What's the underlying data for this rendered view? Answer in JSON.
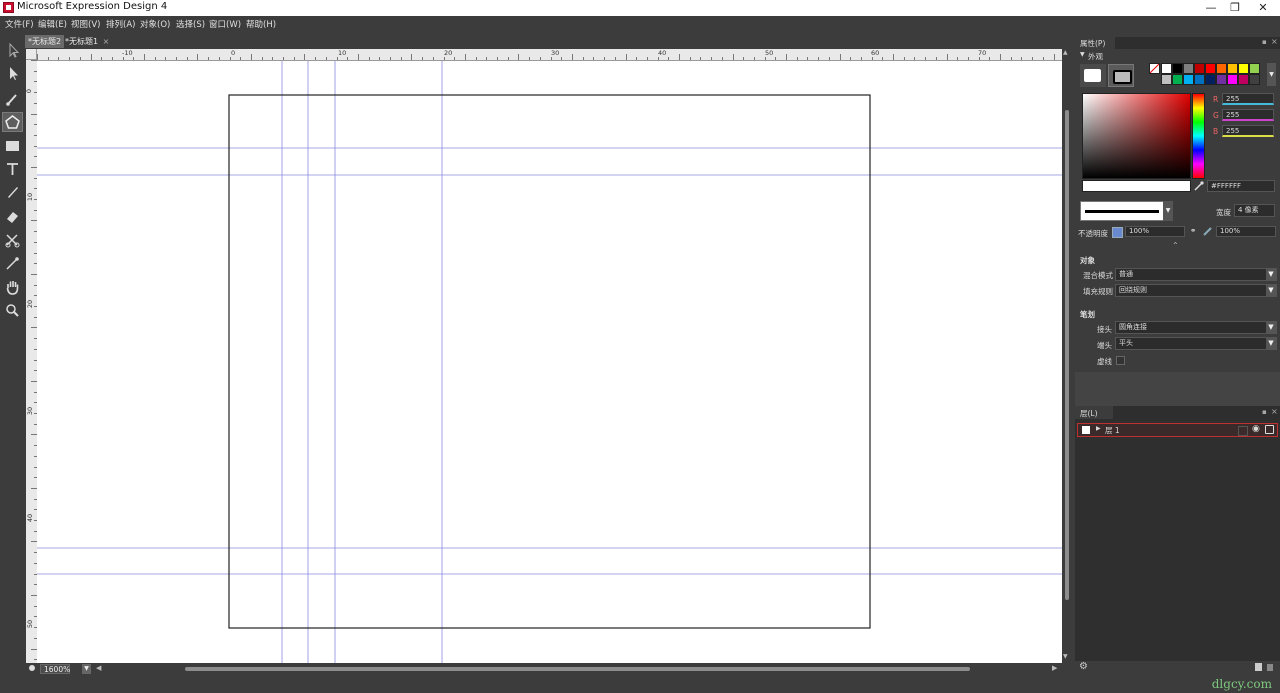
{
  "window": {
    "title": "Microsoft Expression Design 4",
    "controls": [
      "—",
      "❐",
      "✕"
    ]
  },
  "menu": [
    "文件(F)",
    "编辑(E)",
    "视图(V)",
    "排列(A)",
    "对象(O)",
    "选择(S)",
    "窗口(W)",
    "帮助(H)"
  ],
  "tabs": [
    {
      "label": "*无标题2",
      "active": true
    },
    {
      "label": "*无标题1",
      "close": "×",
      "active": false
    }
  ],
  "tools": [
    "selection-icon",
    "direct-selection-icon",
    "paintbrush-icon",
    "polygon-icon",
    "rectangle-icon",
    "text-icon",
    "pen-icon",
    "eraser-icon",
    "scissors-icon",
    "eyedropper-icon",
    "hand-icon",
    "zoom-icon"
  ],
  "ruler": {
    "horizontal": [
      "-10",
      "0",
      "10",
      "20",
      "30",
      "40",
      "50",
      "60",
      "70"
    ],
    "vertical": [
      "0",
      "10",
      "20",
      "30",
      "40",
      "50"
    ]
  },
  "status": {
    "zoom": "1600%"
  },
  "properties": {
    "title": "属性(P)",
    "appearance": "外观",
    "rgb": {
      "r_label": "R",
      "r": "255",
      "g_label": "G",
      "g": "255",
      "b_label": "B",
      "b": "255"
    },
    "hex": "#FFFFFF",
    "width_label": "宽度",
    "width_value": "4 像素",
    "opacity_label": "不透明度",
    "opacity": "100%",
    "opacity2": "100%",
    "object_section": "对象",
    "blend_label": "混合模式",
    "blend_value": "普通",
    "fill_label": "填充规则",
    "fill_value": "回绕规则",
    "stroke_section": "笔划",
    "join_label": "接头",
    "join_value": "圆角连接",
    "cap_label": "端头",
    "cap_value": "平头",
    "dash_label": "虚线"
  },
  "swatches": [
    "#ffffff",
    "#000000",
    "#7f7f7f",
    "#c00000",
    "#ff0000",
    "#ff6600",
    "#ffc000",
    "#ffff00",
    "#92d050",
    "#bfbfbf",
    "#00b050",
    "#00b0f0",
    "#0070c0",
    "#002060",
    "#7030a0",
    "#ff00ff",
    "#c00060",
    "#404040"
  ],
  "layers": {
    "title": "层(L)",
    "items": [
      {
        "name": "层 1"
      }
    ]
  },
  "watermark": "dlgcy.com"
}
